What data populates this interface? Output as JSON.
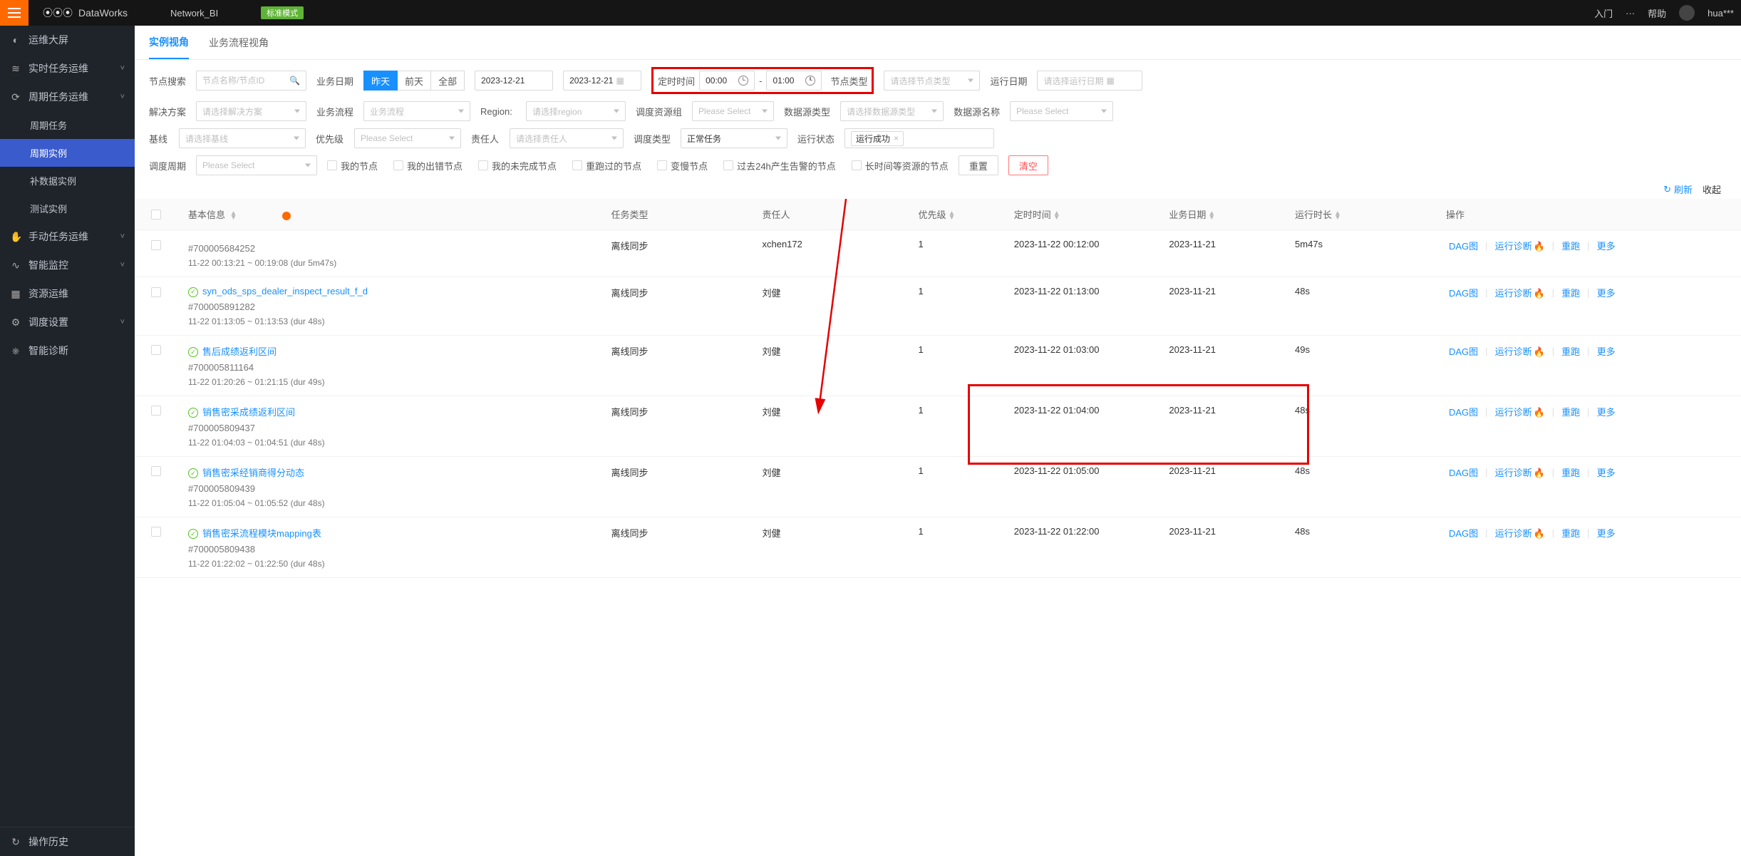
{
  "topbar": {
    "brand": "DataWorks",
    "workspace": "Network_BI",
    "mode_badge": "标准模式",
    "right_items": [
      "入门",
      "···",
      "帮助"
    ],
    "user": "hua***"
  },
  "sidebar": {
    "items": [
      {
        "icon": "◐",
        "label": "运维大屏"
      },
      {
        "icon": "≋",
        "label": "实时任务运维",
        "chev": "˅"
      },
      {
        "icon": "⟳",
        "label": "周期任务运维",
        "chev": "˅",
        "expanded": true
      },
      {
        "sub": true,
        "label": "周期任务"
      },
      {
        "sub": true,
        "label": "周期实例",
        "active": true
      },
      {
        "sub": true,
        "label": "补数据实例"
      },
      {
        "sub": true,
        "label": "测试实例"
      },
      {
        "icon": "✋",
        "label": "手动任务运维",
        "chev": "˅"
      },
      {
        "icon": "∿",
        "label": "智能监控",
        "chev": "˅"
      },
      {
        "icon": "▦",
        "label": "资源运维"
      },
      {
        "icon": "⚙",
        "label": "调度设置",
        "chev": "˅"
      },
      {
        "icon": "⎈",
        "label": "智能诊断"
      }
    ],
    "bottom": {
      "icon": "↻",
      "label": "操作历史"
    }
  },
  "tabs": [
    {
      "label": "实例视角",
      "active": true
    },
    {
      "label": "业务流程视角"
    }
  ],
  "filters": {
    "node_search": {
      "label": "节点搜索",
      "placeholder": "节点名称/节点ID"
    },
    "biz_date": {
      "label": "业务日期",
      "options": [
        "昨天",
        "前天",
        "全部"
      ],
      "active": "昨天",
      "from": "2023-12-21",
      "to": "2023-12-21"
    },
    "sched_time": {
      "label": "定时时间",
      "from": "00:00",
      "to": "01:00"
    },
    "node_type": {
      "label": "节点类型",
      "placeholder": "请选择节点类型"
    },
    "run_date": {
      "label": "运行日期",
      "placeholder": "请选择运行日期"
    },
    "solution": {
      "label": "解决方案",
      "placeholder": "请选择解决方案"
    },
    "biz_flow": {
      "label": "业务流程",
      "placeholder": "业务流程"
    },
    "region": {
      "label": "Region:",
      "placeholder": "请选择region"
    },
    "sched_res": {
      "label": "调度资源组",
      "placeholder": "Please Select"
    },
    "ds_type": {
      "label": "数据源类型",
      "placeholder": "请选择数据源类型"
    },
    "ds_name": {
      "label": "数据源名称",
      "placeholder": "Please Select"
    },
    "baseline": {
      "label": "基线",
      "placeholder": "请选择基线"
    },
    "priority": {
      "label": "优先级",
      "placeholder": "Please Select"
    },
    "owner": {
      "label": "责任人",
      "placeholder": "请选择责任人"
    },
    "sched_type": {
      "label": "调度类型",
      "value": "正常任务"
    },
    "run_status": {
      "label": "运行状态",
      "tags": [
        "运行成功"
      ]
    },
    "sched_cycle": {
      "label": "调度周期",
      "placeholder": "Please Select"
    },
    "checkboxes": [
      "我的节点",
      "我的出错节点",
      "我的未完成节点",
      "重跑过的节点",
      "变慢节点",
      "过去24h产生告警的节点",
      "长时间等资源的节点"
    ],
    "reset_btn": "重置",
    "clear_btn": "清空"
  },
  "tablebar": {
    "refresh": "刷新",
    "collapse": "收起"
  },
  "table": {
    "headers": {
      "info": "基本信息",
      "type": "任务类型",
      "owner": "责任人",
      "priority": "优先级",
      "sched": "定时时间",
      "bizdate": "业务日期",
      "duration": "运行时长",
      "ops": "操作"
    },
    "ops_labels": {
      "dag": "DAG图",
      "diag": "运行诊断",
      "rerun": "重跑",
      "more": "更多"
    },
    "rows": [
      {
        "name": "",
        "id": "#700005684252",
        "range": "11-22 00:13:21 ~ 00:19:08 (dur 5m47s)",
        "type": "离线同步",
        "owner": "xchen172",
        "priority": "1",
        "sched": "2023-11-22 00:12:00",
        "bizdate": "2023-11-21",
        "duration": "5m47s"
      },
      {
        "name": "syn_ods_sps_dealer_inspect_result_f_d",
        "id": "#700005891282",
        "range": "11-22 01:13:05 ~ 01:13:53 (dur 48s)",
        "type": "离线同步",
        "owner": "刘健",
        "priority": "1",
        "sched": "2023-11-22 01:13:00",
        "bizdate": "2023-11-21",
        "duration": "48s"
      },
      {
        "name": "售后成绩返利区间",
        "id": "#700005811164",
        "range": "11-22 01:20:26 ~ 01:21:15 (dur 49s)",
        "type": "离线同步",
        "owner": "刘健",
        "priority": "1",
        "sched": "2023-11-22 01:03:00",
        "bizdate": "2023-11-21",
        "duration": "49s"
      },
      {
        "name": "销售密采成绩返利区间",
        "id": "#700005809437",
        "range": "11-22 01:04:03 ~ 01:04:51 (dur 48s)",
        "type": "离线同步",
        "owner": "刘健",
        "priority": "1",
        "sched": "2023-11-22 01:04:00",
        "bizdate": "2023-11-21",
        "duration": "48s",
        "highlight": true
      },
      {
        "name": "销售密采经销商得分动态",
        "id": "#700005809439",
        "range": "11-22 01:05:04 ~ 01:05:52 (dur 48s)",
        "type": "离线同步",
        "owner": "刘健",
        "priority": "1",
        "sched": "2023-11-22 01:05:00",
        "bizdate": "2023-11-21",
        "duration": "48s"
      },
      {
        "name": "销售密采流程模块mapping表",
        "id": "#700005809438",
        "range": "11-22 01:22:02 ~ 01:22:50 (dur 48s)",
        "type": "离线同步",
        "owner": "刘健",
        "priority": "1",
        "sched": "2023-11-22 01:22:00",
        "bizdate": "2023-11-21",
        "duration": "48s"
      }
    ]
  }
}
